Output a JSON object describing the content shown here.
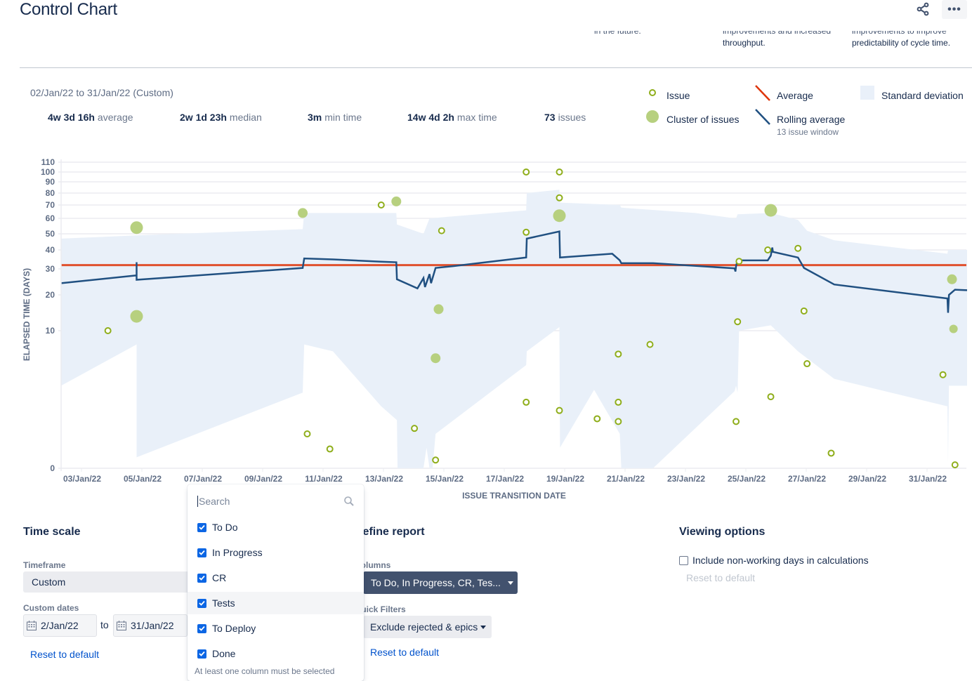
{
  "header": {
    "title": "Control Chart",
    "share_icon": "share-icon",
    "more_icon": "more-horizontal-icon",
    "more_label": "•••"
  },
  "info_cards": [
    {
      "clipped_line": "in the future.",
      "line": ""
    },
    {
      "clipped_line": "improvements and increased",
      "line": "throughput."
    },
    {
      "clipped_line": "improvements to improve",
      "line": "predictability of cycle time."
    }
  ],
  "summary": {
    "range": "02/Jan/22 to 31/Jan/22 (Custom)",
    "stats": [
      {
        "value": "4w 3d 16h",
        "label": "average"
      },
      {
        "value": "2w 1d 23h",
        "label": "median"
      },
      {
        "value": "3m",
        "label": "min time"
      },
      {
        "value": "14w 4d 2h",
        "label": "max time"
      },
      {
        "value": "73",
        "label": "issues"
      }
    ]
  },
  "legend": {
    "issue": "Issue",
    "cluster": "Cluster of issues",
    "average": "Average",
    "rolling": "Rolling average",
    "rolling_sub": "13 issue window",
    "stddev": "Standard deviation",
    "colors": {
      "issue": "#8fae1b",
      "cluster": "#b7d07f",
      "average": "#de350b",
      "rolling": "#205081",
      "stddev": "#e9f0f9"
    }
  },
  "chart_data": {
    "type": "scatter",
    "title": "Control Chart",
    "xlabel": "ISSUE TRANSITION DATE",
    "ylabel": "ELAPSED TIME (DAYS)",
    "x_unit": "day of January 2022",
    "xlim": [
      2,
      32
    ],
    "ylim": [
      0,
      110
    ],
    "y_scale": "non-linear (compressed at top)",
    "y_ticks": [
      0,
      10,
      20,
      30,
      40,
      50,
      60,
      70,
      80,
      90,
      100,
      110
    ],
    "x_ticks": [
      "03/Jan/22",
      "05/Jan/22",
      "07/Jan/22",
      "09/Jan/22",
      "11/Jan/22",
      "13/Jan/22",
      "15/Jan/22",
      "17/Jan/22",
      "19/Jan/22",
      "21/Jan/22",
      "23/Jan/22",
      "25/Jan/22",
      "27/Jan/22",
      "29/Jan/22",
      "31/Jan/22"
    ],
    "x_tick_values": [
      3,
      5,
      7,
      9,
      11,
      13,
      15,
      17,
      19,
      21,
      23,
      25,
      27,
      29,
      31
    ],
    "grid": true,
    "legend_position": "top-right",
    "average": 32,
    "issues": [
      {
        "x": 3.55,
        "y": 10
      },
      {
        "x": 10.15,
        "y": 2.5
      },
      {
        "x": 10.9,
        "y": 1.4
      },
      {
        "x": 12.6,
        "y": 70
      },
      {
        "x": 13.7,
        "y": 2.9
      },
      {
        "x": 14.4,
        "y": 0.6
      },
      {
        "x": 14.6,
        "y": 52
      },
      {
        "x": 17.4,
        "y": 100
      },
      {
        "x": 17.4,
        "y": 51
      },
      {
        "x": 17.4,
        "y": 4.8
      },
      {
        "x": 18.5,
        "y": 100
      },
      {
        "x": 18.5,
        "y": 76
      },
      {
        "x": 18.5,
        "y": 4.2
      },
      {
        "x": 19.75,
        "y": 3.6
      },
      {
        "x": 20.45,
        "y": 8.3
      },
      {
        "x": 20.45,
        "y": 4.8
      },
      {
        "x": 20.45,
        "y": 3.4
      },
      {
        "x": 21.5,
        "y": 9
      },
      {
        "x": 24.4,
        "y": 12.5
      },
      {
        "x": 24.35,
        "y": 3.4
      },
      {
        "x": 24.45,
        "y": 34
      },
      {
        "x": 25.4,
        "y": 40
      },
      {
        "x": 25.5,
        "y": 5.2
      },
      {
        "x": 26.4,
        "y": 41
      },
      {
        "x": 26.6,
        "y": 15.5
      },
      {
        "x": 26.7,
        "y": 7.6
      },
      {
        "x": 27.5,
        "y": 1.1
      },
      {
        "x": 31.2,
        "y": 6.8
      },
      {
        "x": 31.6,
        "y": 0.25
      }
    ],
    "clusters": [
      {
        "x": 4.5,
        "y": 54,
        "size": "large"
      },
      {
        "x": 4.5,
        "y": 14,
        "size": "large"
      },
      {
        "x": 10,
        "y": 64,
        "size": "medium"
      },
      {
        "x": 13.1,
        "y": 73,
        "size": "medium"
      },
      {
        "x": 14.5,
        "y": 16,
        "size": "medium"
      },
      {
        "x": 14.4,
        "y": 8,
        "size": "medium"
      },
      {
        "x": 18.5,
        "y": 62,
        "size": "large"
      },
      {
        "x": 25.5,
        "y": 66,
        "size": "large"
      },
      {
        "x": 31.5,
        "y": 26,
        "size": "medium"
      },
      {
        "x": 31.55,
        "y": 10.5,
        "size": "small"
      }
    ],
    "rolling_average": [
      [
        2,
        24.5
      ],
      [
        4.5,
        27.5
      ],
      [
        4.5,
        33.5
      ],
      [
        4.5,
        25.8
      ],
      [
        10,
        30.5
      ],
      [
        10.05,
        35.5
      ],
      [
        11,
        35
      ],
      [
        12.6,
        33.8
      ],
      [
        13.1,
        33.5
      ],
      [
        13.12,
        26
      ],
      [
        13.8,
        22.5
      ],
      [
        14.0,
        26.5
      ],
      [
        14.05,
        23
      ],
      [
        14.2,
        28
      ],
      [
        14.25,
        24.5
      ],
      [
        14.4,
        30.5
      ],
      [
        15.0,
        31.5
      ],
      [
        17.4,
        36
      ],
      [
        17.42,
        47
      ],
      [
        18.5,
        51.5
      ],
      [
        18.52,
        36
      ],
      [
        20.25,
        38
      ],
      [
        20.5,
        34.5
      ],
      [
        20.55,
        33
      ],
      [
        21.6,
        33
      ],
      [
        24.3,
        30.3
      ],
      [
        24.33,
        29
      ],
      [
        24.35,
        31.5
      ],
      [
        24.4,
        34.5
      ],
      [
        25.4,
        34.5
      ],
      [
        25.5,
        37
      ],
      [
        25.55,
        41.5
      ],
      [
        25.57,
        39
      ],
      [
        26.4,
        36
      ],
      [
        26.6,
        30.5
      ],
      [
        27.6,
        24
      ],
      [
        31.35,
        19
      ],
      [
        31.37,
        15
      ],
      [
        31.4,
        20
      ],
      [
        31.6,
        22
      ],
      [
        32,
        21.8
      ]
    ],
    "std_dev_upper": [
      [
        2,
        47
      ],
      [
        4.5,
        49
      ],
      [
        10,
        53
      ],
      [
        10.05,
        64
      ],
      [
        13.1,
        64
      ],
      [
        13.12,
        56
      ],
      [
        14.0,
        50
      ],
      [
        14.2,
        60
      ],
      [
        17.4,
        66
      ],
      [
        17.42,
        80
      ],
      [
        18.5,
        83
      ],
      [
        18.52,
        72
      ],
      [
        20.5,
        70
      ],
      [
        20.55,
        68
      ],
      [
        23.0,
        64
      ],
      [
        24.3,
        60
      ],
      [
        24.35,
        60
      ],
      [
        24.4,
        63
      ],
      [
        25.5,
        64
      ],
      [
        26.4,
        59
      ],
      [
        26.7,
        52
      ],
      [
        27.6,
        46
      ],
      [
        31.35,
        38
      ],
      [
        31.37,
        40
      ],
      [
        32,
        40
      ]
    ],
    "std_dev_lower": [
      [
        2,
        6
      ],
      [
        4.5,
        9
      ],
      [
        4.5,
        0.8
      ],
      [
        10,
        5.5
      ],
      [
        10.05,
        9
      ],
      [
        11,
        8.5
      ],
      [
        12.6,
        4.5
      ],
      [
        13.12,
        3.5
      ],
      [
        13.14,
        0
      ],
      [
        14.0,
        0
      ],
      [
        14.1,
        1.5
      ],
      [
        14.2,
        0
      ],
      [
        14.3,
        0
      ],
      [
        14.4,
        2.5
      ],
      [
        17.4,
        7.5
      ],
      [
        17.42,
        8.5
      ],
      [
        18.5,
        11
      ],
      [
        18.52,
        1.5
      ],
      [
        19.65,
        5.7
      ],
      [
        20.5,
        2.5
      ],
      [
        20.55,
        0
      ],
      [
        21.6,
        0
      ],
      [
        24.3,
        5.6
      ],
      [
        24.35,
        6
      ],
      [
        24.4,
        5.5
      ],
      [
        24.45,
        10
      ],
      [
        25.5,
        11.5
      ],
      [
        26.4,
        8.5
      ],
      [
        27.6,
        6.5
      ],
      [
        31.35,
        4.5
      ],
      [
        31.37,
        0.4
      ],
      [
        31.4,
        6
      ],
      [
        32,
        6
      ]
    ]
  },
  "time_scale": {
    "title": "Time scale",
    "timeframe_label": "Timeframe",
    "timeframe_value": "Custom",
    "custom_dates_label": "Custom dates",
    "from": "2/Jan/22",
    "to_label": "to",
    "to": "31/Jan/22",
    "reset": "Reset to default",
    "calendar_icon": "calendar-icon"
  },
  "refine": {
    "title": "Refine report",
    "columns_label": "Columns",
    "columns_value": "To Do, In Progress, CR, Tes...",
    "quick_filters_label": "Quick Filters",
    "quick_filters_value": "Exclude rejected & epics",
    "reset": "Reset to default"
  },
  "columns_dropdown": {
    "search_placeholder": "Search",
    "items": [
      {
        "label": "To Do",
        "checked": true
      },
      {
        "label": "In Progress",
        "checked": true
      },
      {
        "label": "CR",
        "checked": true
      },
      {
        "label": "Tests",
        "checked": true
      },
      {
        "label": "To Deploy",
        "checked": true
      },
      {
        "label": "Done",
        "checked": true
      }
    ],
    "note": "At least one column must be selected"
  },
  "viewing": {
    "title": "Viewing options",
    "non_working_label": "Include non-working days in calculations",
    "non_working_checked": false,
    "reset": "Reset to default"
  }
}
